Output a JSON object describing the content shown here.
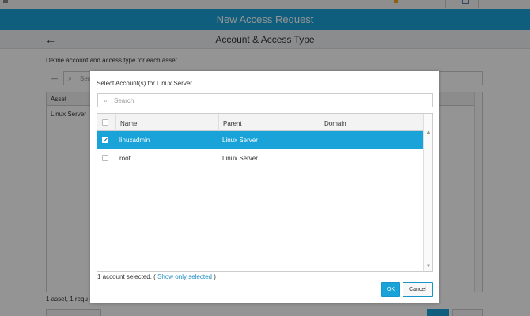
{
  "app": {
    "title": "New Access Request",
    "accent_color": "#1aa3d8"
  },
  "sub_header": {
    "back_icon": "back-arrow-icon",
    "title": "Account & Access Type"
  },
  "background": {
    "description": "Define account and access type for each asset.",
    "search_placeholder": "Sea",
    "table_header_asset": "Asset",
    "table_row_asset": "Linux Server",
    "footer_text": "1 asset, 1 requ"
  },
  "modal": {
    "title": "Select Account(s) for Linux Server",
    "search_placeholder": "Search",
    "columns": [
      "Name",
      "Parent",
      "Domain"
    ],
    "rows": [
      {
        "name": "linuxadmin",
        "parent": "Linux Server",
        "domain": "",
        "checked": true,
        "check_mark": "✔"
      },
      {
        "name": "root",
        "parent": "Linux Server",
        "domain": "",
        "checked": false,
        "check_mark": ""
      }
    ],
    "status_prefix": "1 account selected. (",
    "status_link": "Show only selected",
    "status_suffix": ")",
    "ok_label": "OK",
    "cancel_label": "Cancel"
  }
}
